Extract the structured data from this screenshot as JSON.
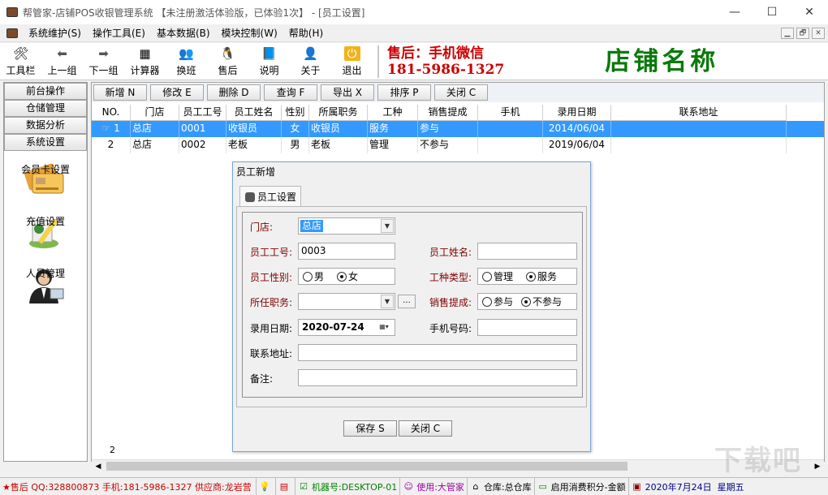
{
  "window": {
    "title": "帮管家-店铺POS收银管理系统 【未注册激活体验版，已体验1次】 - [员工设置]",
    "minimize": "—",
    "maximize": "☐",
    "close": "✕"
  },
  "menu": [
    "系统维护(S)",
    "操作工具(E)",
    "基本数据(B)",
    "模块控制(W)",
    "帮助(H)"
  ],
  "mdi_controls": [
    "▁",
    "🗗",
    "✕"
  ],
  "toolbar": [
    {
      "label": "工具栏",
      "icon": "toolbox-icon",
      "glyph": "🛠"
    },
    {
      "label": "上一组",
      "icon": "arrow-left-icon",
      "glyph": "⬅"
    },
    {
      "label": "下一组",
      "icon": "arrow-right-icon",
      "glyph": "➡"
    },
    {
      "label": "计算器",
      "icon": "calculator-icon",
      "glyph": "▦"
    },
    {
      "label": "换班",
      "icon": "users-icon",
      "glyph": "👥"
    },
    {
      "label": "售后",
      "icon": "penguin-icon",
      "glyph": "🐧"
    },
    {
      "label": "说明",
      "icon": "book-icon",
      "glyph": "📘"
    },
    {
      "label": "关于",
      "icon": "person-card-icon",
      "glyph": "👤"
    },
    {
      "label": "退出",
      "icon": "exit-icon",
      "glyph": "⏻"
    }
  ],
  "promo": {
    "line1": "售后：手机微信",
    "line2": "181-5986-1327"
  },
  "shop_name": "店铺名称",
  "left_nav": {
    "buttons": [
      "前台操作",
      "仓储管理",
      "数据分析",
      "系统设置"
    ],
    "items": [
      {
        "label": "会员卡设置",
        "icon": "member-card-icon"
      },
      {
        "label": "充值设置",
        "icon": "recharge-icon"
      },
      {
        "label": "人员管理",
        "icon": "staff-icon"
      }
    ]
  },
  "actions": [
    "新增 N",
    "修改 E",
    "删除 D",
    "查询 F",
    "导出 X",
    "排序 P",
    "关闭 C"
  ],
  "grid": {
    "headers": [
      "NO.",
      "门店",
      "员工工号",
      "员工姓名",
      "性别",
      "所属职务",
      "工种",
      "销售提成",
      "手机",
      "录用日期",
      "联系地址"
    ],
    "rows": [
      [
        "1",
        "总店",
        "0001",
        "收银员",
        "女",
        "收银员",
        "服务",
        "参与",
        "",
        "2014/06/04",
        ""
      ],
      [
        "2",
        "总店",
        "0002",
        "老板",
        "男",
        "老板",
        "管理",
        "不参与",
        "",
        "2019/06/04",
        ""
      ]
    ],
    "footer_count": "2"
  },
  "dialog": {
    "title": "员工新增",
    "tab": "员工设置",
    "labels": {
      "store": "门店:",
      "emp_no": "员工工号:",
      "emp_name": "员工姓名:",
      "gender": "员工性别:",
      "work_type": "工种类型:",
      "position": "所任职务:",
      "commission": "销售提成:",
      "hire_date": "录用日期:",
      "phone": "手机号码:",
      "address": "联系地址:",
      "remark": "备注:"
    },
    "values": {
      "store": "总店",
      "emp_no": "0003",
      "emp_name": "",
      "position": "",
      "hire_date": "2020-07-24",
      "phone": "",
      "address": "",
      "remark": ""
    },
    "gender_options": [
      {
        "label": "男",
        "checked": false
      },
      {
        "label": "女",
        "checked": true
      }
    ],
    "work_type_options": [
      {
        "label": "管理",
        "checked": false
      },
      {
        "label": "服务",
        "checked": true
      }
    ],
    "commission_options": [
      {
        "label": "参与",
        "checked": false
      },
      {
        "label": "不参与",
        "checked": true
      }
    ],
    "ellipsis": "...",
    "save": "保存 S",
    "close": "关闭 C"
  },
  "statusbar": {
    "contact": "★售后 QQ:328800873 手机:181-5986-1327 供应商:龙岩营",
    "machine": "机器号:DESKTOP-01",
    "user": "使用:大管家",
    "warehouse": "仓库:总仓库",
    "points": "启用消费积分-金额",
    "date": "2020年7月24日",
    "weekday": "星期五"
  },
  "watermark": "下载吧",
  "colors": {
    "selection": "#3399ff",
    "promo": "#cc0000",
    "shop": "#0a7a0a",
    "label": "#800000"
  }
}
